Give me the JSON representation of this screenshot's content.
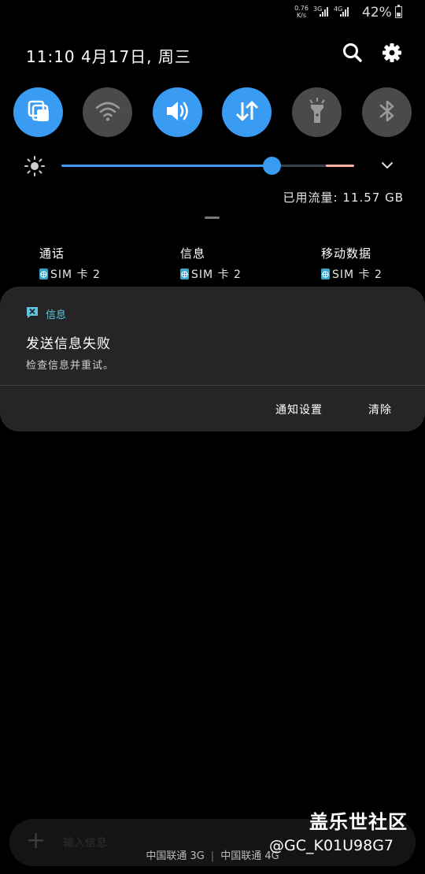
{
  "status": {
    "net_speed_value": "0.76",
    "net_speed_unit": "K/s",
    "sim1_type": "3G",
    "sim2_type": "4G",
    "battery": "42%",
    "battery_level": 0.42
  },
  "header": {
    "datetime": "11:10 4月17日, 周三",
    "icons": [
      "search-icon",
      "gear-icon"
    ]
  },
  "quick_settings": [
    {
      "name": "multi-window",
      "icon": "multi-window-icon",
      "on": true
    },
    {
      "name": "wifi",
      "icon": "wifi-icon",
      "on": false
    },
    {
      "name": "sound",
      "icon": "volume-icon",
      "on": true
    },
    {
      "name": "mobile-data",
      "icon": "data-arrows-icon",
      "on": true
    },
    {
      "name": "flashlight",
      "icon": "flashlight-icon",
      "on": false
    },
    {
      "name": "bluetooth",
      "icon": "bluetooth-icon",
      "on": false
    }
  ],
  "brightness": {
    "level": 0.72
  },
  "data_usage": "已用流量: 11.57 GB",
  "sim_defaults": [
    {
      "title": "通话",
      "value": "SIM 卡 2"
    },
    {
      "title": "信息",
      "value": "SIM 卡 2"
    },
    {
      "title": "移动数据",
      "value": "SIM 卡 2"
    }
  ],
  "notification": {
    "app": "信息",
    "title": "发送信息失败",
    "body": "检查信息并重试。",
    "actions": [
      "通知设置",
      "清除"
    ]
  },
  "background_app": {
    "input_placeholder": "输入信息",
    "carrier_sim1": "中国联通 3G",
    "carrier_sim2": "中国联通 4G"
  },
  "watermark": {
    "site": "盖乐世社区",
    "user": "@GC_K01U98G7"
  },
  "colors": {
    "accent": "#3a9bf2",
    "toggle_off": "#4a4a4a",
    "card": "#252525",
    "app_name": "#5fc5df"
  }
}
